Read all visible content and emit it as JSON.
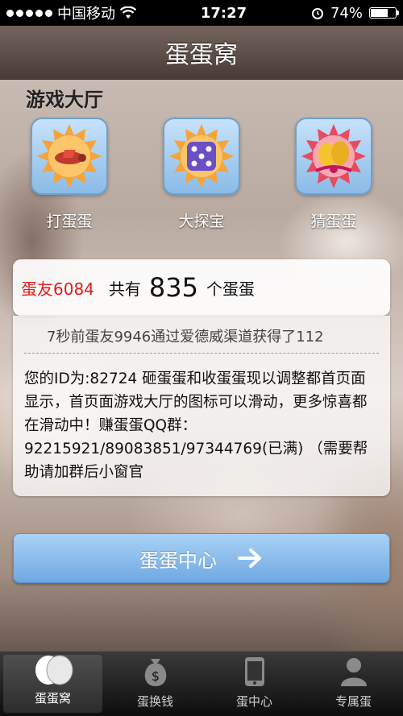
{
  "status_bar": {
    "carrier": "中国移动",
    "time": "17:27",
    "battery": "74%",
    "battery_level": 0.74
  },
  "header": {
    "title": "蛋蛋窝"
  },
  "lobby": {
    "title": "游戏大厅",
    "games": [
      {
        "label": "打蛋蛋",
        "icon": "plane-egg-icon"
      },
      {
        "label": "大探宝",
        "icon": "dice-icon"
      },
      {
        "label": "猜蛋蛋",
        "icon": "golden-eggs-icon"
      }
    ]
  },
  "summary": {
    "user": "蛋友6084",
    "has": "共有",
    "count": "835",
    "unit": "个蛋蛋"
  },
  "ticker": "7秒前蛋友9946通过爱德威渠道获得了112",
  "notice": "您的ID为:82724  砸蛋蛋和收蛋蛋现以调整都首页面显示，首页面游戏大厅的图标可以滑动，更多惊喜都在滑动中！赚蛋蛋QQ群：92215921/89083851/97344769(已满) （需要帮助请加群后小窗官",
  "main_button": {
    "label": "蛋蛋中心",
    "icon": "arrow-right-icon"
  },
  "tabs": [
    {
      "label": "蛋蛋窝",
      "icon": "eggs-icon",
      "active": true
    },
    {
      "label": "蛋换钱",
      "icon": "money-bag-icon",
      "active": false
    },
    {
      "label": "蛋中心",
      "icon": "phone-icon",
      "active": false
    },
    {
      "label": "专属蛋",
      "icon": "person-icon",
      "active": false
    }
  ],
  "colors": {
    "user_name": "#e01b1b",
    "button_blue": "#6fa8e1",
    "tile_blue": "#8bbbe6"
  }
}
